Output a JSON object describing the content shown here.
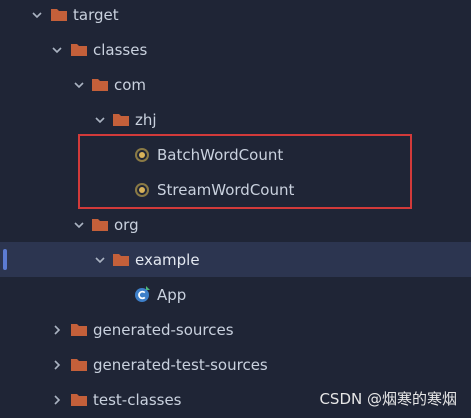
{
  "tree": {
    "items": [
      {
        "label": "target",
        "icon": "folder-icon",
        "expanded": true
      },
      {
        "label": "classes",
        "icon": "folder-icon",
        "expanded": true
      },
      {
        "label": "com",
        "icon": "folder-icon",
        "expanded": true
      },
      {
        "label": "zhj",
        "icon": "folder-icon",
        "expanded": true
      },
      {
        "label": "BatchWordCount",
        "icon": "class-file-icon"
      },
      {
        "label": "StreamWordCount",
        "icon": "class-file-icon"
      },
      {
        "label": "org",
        "icon": "folder-icon",
        "expanded": true
      },
      {
        "label": "example",
        "icon": "folder-icon",
        "expanded": true,
        "selected": true
      },
      {
        "label": "App",
        "icon": "java-class-icon"
      },
      {
        "label": "generated-sources",
        "icon": "folder-icon",
        "expanded": false
      },
      {
        "label": "generated-test-sources",
        "icon": "folder-icon",
        "expanded": false
      },
      {
        "label": "test-classes",
        "icon": "folder-icon",
        "expanded": false
      }
    ]
  },
  "watermark": "CSDN @烟寒的寒烟",
  "colors": {
    "background": "#1f2536",
    "selected_row": "#2c3550",
    "folder": "#c4603a",
    "highlight_border": "#d23a3a"
  }
}
